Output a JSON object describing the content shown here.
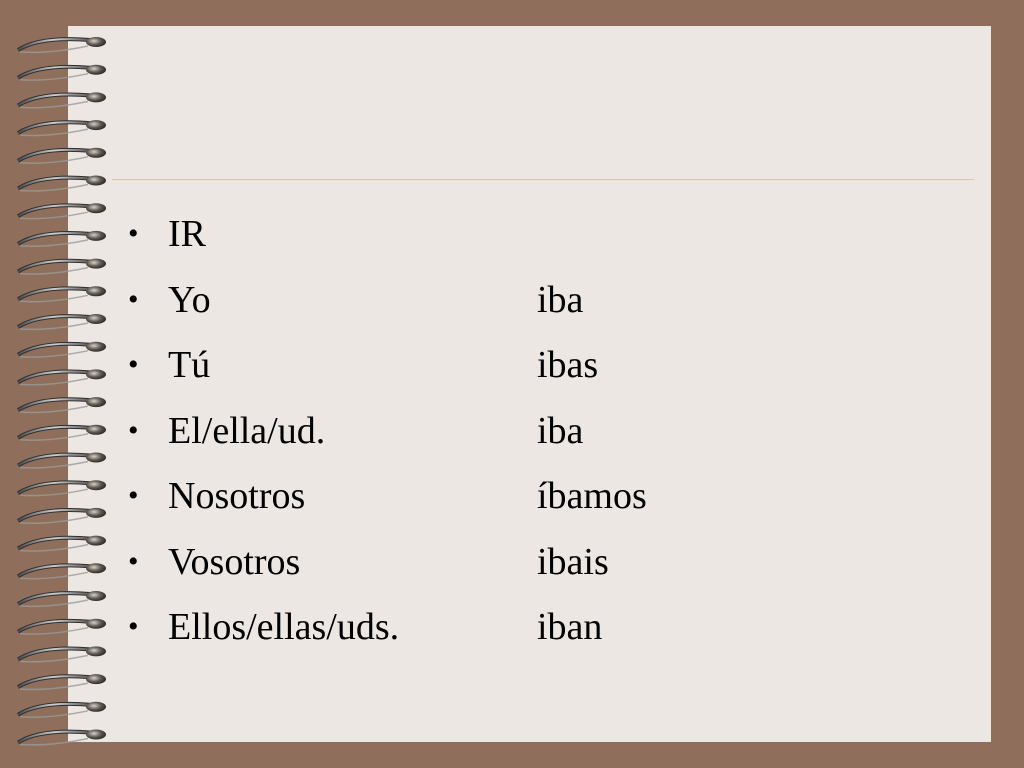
{
  "slide": {
    "title": "IR",
    "rows": [
      {
        "pronoun": "Yo",
        "form": "iba"
      },
      {
        "pronoun": "Tú",
        "form": "ibas"
      },
      {
        "pronoun": "El/ella/ud.",
        "form": "iba"
      },
      {
        "pronoun": "Nosotros",
        "form": "íbamos"
      },
      {
        "pronoun": "Vosotros",
        "form": "ibais"
      },
      {
        "pronoun": "Ellos/ellas/uds.",
        "form": "iban"
      }
    ],
    "bullet": "•"
  },
  "colors": {
    "background": "#8f6f5c",
    "paper": "#ece7e3",
    "rule": "#d8c7ad",
    "text": "#000000"
  },
  "icons": {
    "binding": "spiral-binding-icon"
  }
}
